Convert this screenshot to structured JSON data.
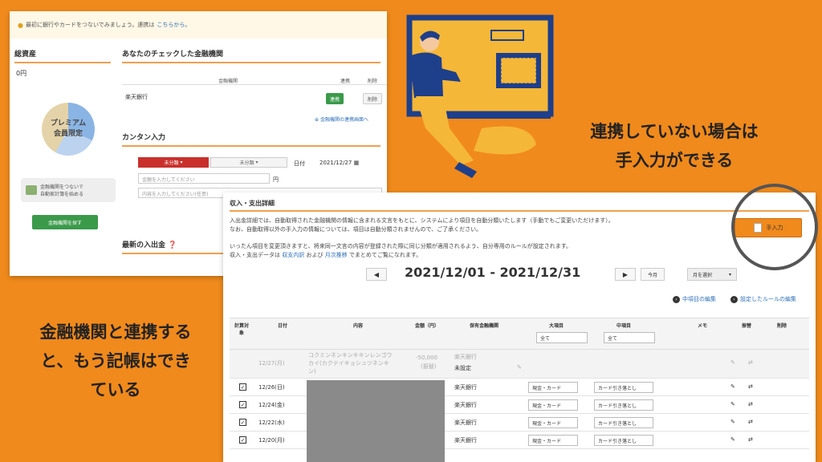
{
  "panel1": {
    "alert_text": "最初に銀行やカードをつないでみましょう。連携は",
    "alert_link": "こちらから。",
    "total_assets_title": "総資産",
    "total_assets_value": "0円",
    "premium_line1": "プレミアム",
    "premium_line2": "会員限定",
    "connect_line1": "金融機関をつないで",
    "connect_line2": "自動家計簿を始める",
    "find_bank_button": "金融機関を探す",
    "checked_title": "あなたのチェックした金融機関",
    "col_bank": "金融機関",
    "col_link": "連携",
    "col_delete": "削除",
    "bank_name": "楽天銀行",
    "link_button": "連携",
    "delete_button": "削除",
    "bank_link_text": "金融機関の連携画面へ",
    "easy_input_title": "カンタン入力",
    "cat_major": "未分類",
    "cat_minor": "未分類",
    "date_label": "日付",
    "date_value": "2021/12/27",
    "amount_placeholder": "金額を入力してください",
    "yen_unit": "円",
    "content_placeholder": "内容を入力してください(任意)",
    "recent_title": "最新の入出金"
  },
  "panel2": {
    "title": "収入・支出詳細",
    "desc1": "入出金詳細では、自動取得された金融機関の情報に含まれる文言をもとに、システムにより項目を自動分類いたします（手動でもご変更いただけます）。",
    "desc2": "なお、自動取得以外の手入力の情報については、項目は自動分類されませんので、ご了承ください。",
    "desc3": "いったん項目を変更頂きますと、将来同一文言の内容が登録された際に同じ分類が適用されるよう、自分専用のルールが設定されます。",
    "desc4_pre": "収入・支出データは",
    "desc4_link1": "収支内訳",
    "desc4_mid": "および",
    "desc4_link2": "月次推移",
    "desc4_post": "でまとめてご覧になれます。",
    "manual_button": "手入力",
    "prev": "◀",
    "period": "2021/12/01 - 2021/12/31",
    "next": "▶",
    "today": "今月",
    "month_select": "月を選択",
    "edit_mid": "中項目の編集",
    "edit_rules": "設定したルールの編集",
    "headers": {
      "calc": "計算対象",
      "date": "日付",
      "content": "内容",
      "amount": "金額（円）",
      "bank": "保有金融機関",
      "major": "大項目",
      "minor": "中項目",
      "memo": "メモ",
      "transfer": "振替",
      "delete": "削除",
      "all1": "全て",
      "all2": "全て"
    },
    "gray_row": {
      "date": "12/27(月)",
      "content1": "コクミンネンキンキキンレンゴウ",
      "content2": "カイ(カクテイキョシュツネンキ",
      "content3": "ン)",
      "amount1": "-50,000",
      "amount2": "(振替)",
      "bank": "楽天銀行",
      "unset": "未設定"
    },
    "rows": [
      {
        "date": "12/26(日)",
        "bank": "楽天銀行",
        "major": "現金・カード",
        "minor": "カード引き落とし"
      },
      {
        "date": "12/24(金)",
        "bank": "楽天銀行",
        "major": "現金・カード",
        "minor": "カード引き落とし"
      },
      {
        "date": "12/22(水)",
        "bank": "楽天銀行",
        "major": "現金・カード",
        "minor": "カード引き落とし"
      },
      {
        "date": "12/20(月)",
        "bank": "楽天銀行",
        "major": "現金・カード",
        "minor": "カード引き落とし"
      }
    ]
  },
  "caption_right_1": "連携していない場合は",
  "caption_right_2": "手入力ができる",
  "caption_left_1": "金融機関と連携する",
  "caption_left_2": "と、もう記帳はでき",
  "caption_left_3": "ている",
  "colors": {
    "background": "#f08a1c",
    "link_green": "#3a9a4a",
    "red": "#c9302c",
    "accent_line": "#f0a050"
  }
}
